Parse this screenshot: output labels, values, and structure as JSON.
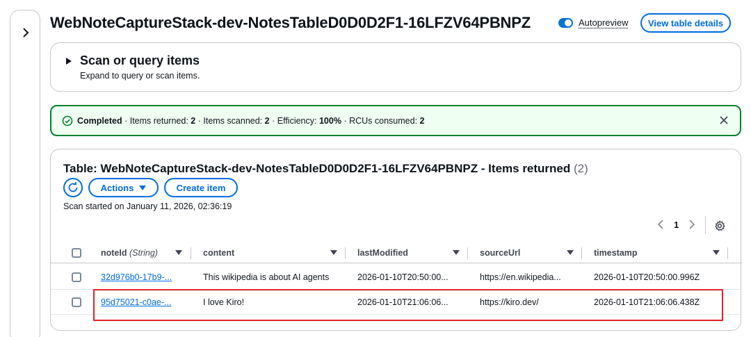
{
  "page": {
    "title": "WebNoteCaptureStack-dev-NotesTableD0D0D2F1-16LFZV64PBNPZ",
    "autopreview_label": "Autopreview",
    "view_details_label": "View table details"
  },
  "scan_panel": {
    "title": "Scan or query items",
    "description": "Expand to query or scan items."
  },
  "flash": {
    "status": "Completed",
    "items_returned_label": "Items returned:",
    "items_returned": "2",
    "items_scanned_label": "Items scanned:",
    "items_scanned": "2",
    "efficiency_label": "Efficiency:",
    "efficiency": "100%",
    "rcus_label": "RCUs consumed:",
    "rcus": "2",
    "separator": "·",
    "status_color": "#00802f"
  },
  "results": {
    "title": "Table: WebNoteCaptureStack-dev-NotesTableD0D0D2F1-16LFZV64PBNPZ - Items returned",
    "count": "(2)",
    "actions_label": "Actions",
    "create_label": "Create item",
    "scan_started": "Scan started on January 11, 2026, 02:36:19",
    "page_number": "1",
    "columns": [
      {
        "name": "noteId",
        "type": "(String)"
      },
      {
        "name": "content",
        "type": ""
      },
      {
        "name": "lastModified",
        "type": ""
      },
      {
        "name": "sourceUrl",
        "type": ""
      },
      {
        "name": "timestamp",
        "type": ""
      }
    ],
    "rows": [
      {
        "noteId": "32d976b0-17b9-...",
        "content": "This wikipedia is about AI agents",
        "lastModified": "2026-01-10T20:50:00...",
        "sourceUrl": "https://en.wikipedia...",
        "timestamp": "2026-01-10T20:50:00.996Z"
      },
      {
        "noteId": "95d75021-c0ae-...",
        "content": "I love Kiro!",
        "lastModified": "2026-01-10T21:06:06...",
        "sourceUrl": "https://kiro.dev/",
        "timestamp": "2026-01-10T21:06:06.438Z"
      }
    ]
  },
  "colors": {
    "accent": "#006ce0",
    "success": "#00802f",
    "highlight": "#e0232b"
  },
  "icons": [
    "chevron-right-icon",
    "check-circle-icon",
    "close-icon",
    "refresh-icon",
    "caret-down-icon",
    "chevron-left-icon",
    "settings-icon",
    "sort-icon"
  ]
}
